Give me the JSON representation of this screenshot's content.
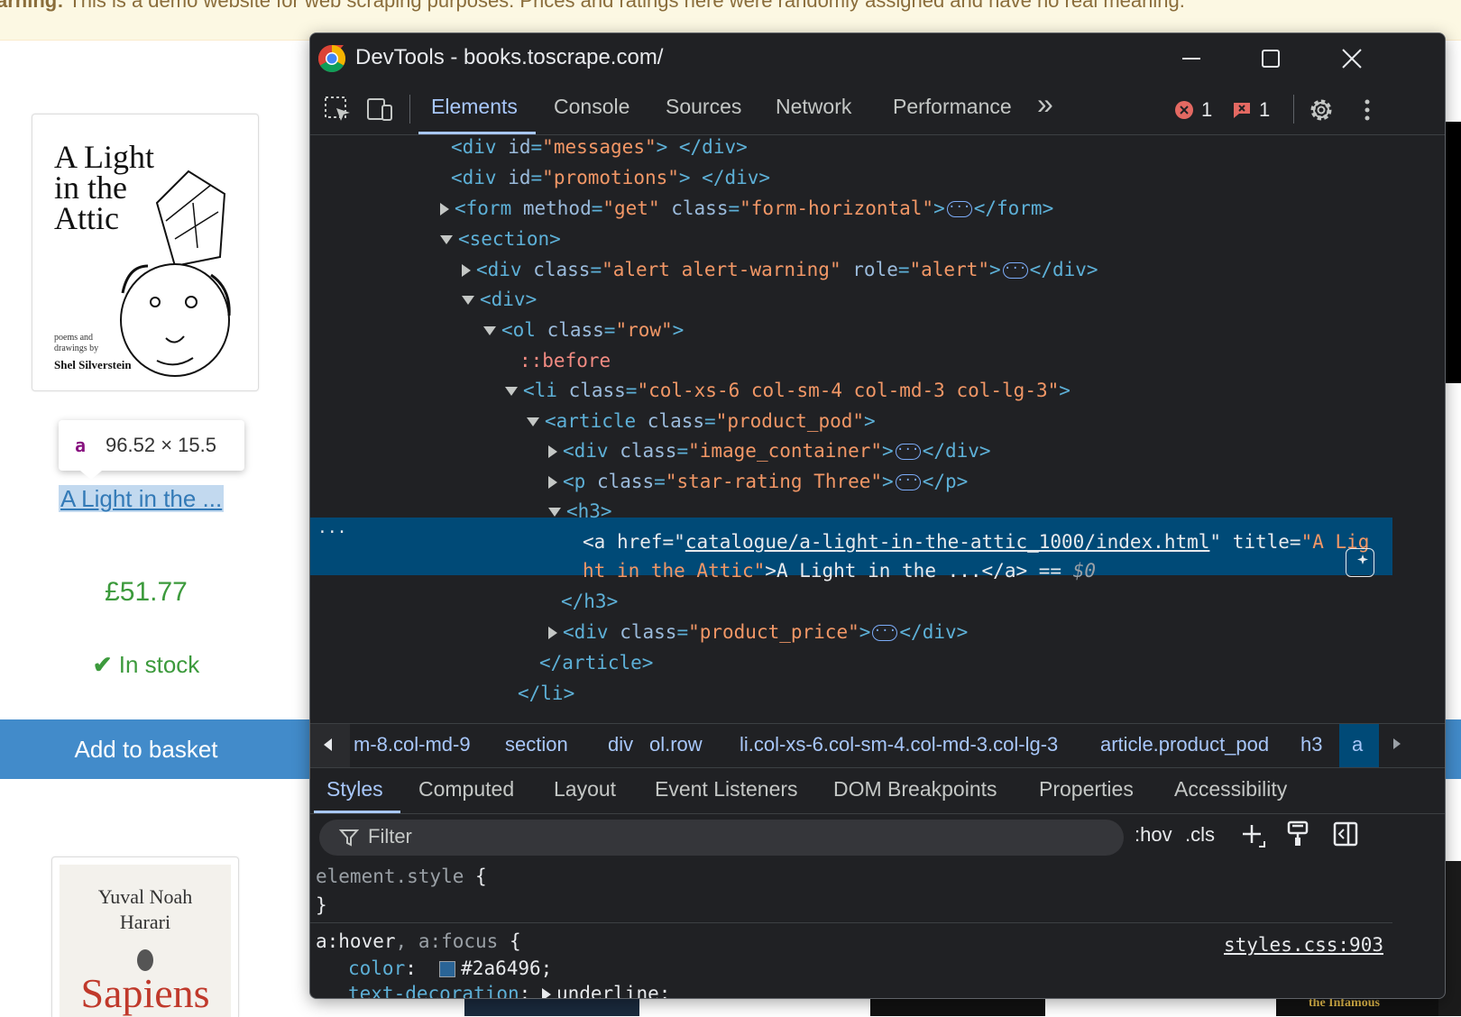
{
  "page": {
    "warning_prefix": "arning:",
    "warning_text": " This is a demo website for web scraping purposes. Prices and ratings here were randomly assigned and have no real meaning.",
    "book1": {
      "cover_title": "A Light\nin the\nAttic",
      "cover_sub": "poems and\ndrawings by",
      "cover_author": "Shel Silverstein",
      "link_text": "A Light in the ...",
      "price": "£51.77",
      "stock": "In stock",
      "basket": "Add to basket"
    },
    "book2": {
      "cover_author": "Yuval Noah\nHarari",
      "cover_title": "Sapiens"
    },
    "bottom_thumb_text": "the Infamous",
    "tooltip": {
      "tag": "a",
      "dims": "96.52 × 15.5"
    }
  },
  "devtools": {
    "title": "DevTools - books.toscrape.com/",
    "tabs": [
      "Elements",
      "Console",
      "Sources",
      "Network",
      "Performance"
    ],
    "more": "»",
    "errors": "1",
    "issues": "1",
    "dom": {
      "l1": {
        "tag": "div",
        "attr": "id",
        "val": "\"messages\""
      },
      "l2": {
        "tag": "div",
        "attr": "id",
        "val": "\"promotions\""
      },
      "l3": {
        "attr1": "method",
        "val1": "\"get\"",
        "attr2": "class",
        "val2": "\"form-horizontal\""
      },
      "l5": {
        "val1": "\"alert alert-warning\"",
        "attr2": "role",
        "val2": "\"alert\""
      },
      "l7": {
        "val": "\"row\""
      },
      "l8": "::before",
      "l9": {
        "val": "\"col-xs-6 col-sm-4 col-md-3 col-lg-3\""
      },
      "l10": {
        "val": "\"product_pod\""
      },
      "l11": {
        "val": "\"image_container\""
      },
      "l12": {
        "val": "\"star-rating Three\""
      },
      "sel": {
        "href": "catalogue/a-light-in-the-attic_1000/index.html",
        "title_part1": "\"A Lig",
        "title_part2": "ht in the Attic\"",
        "text": "A Light in the ...",
        "dollar": "$0"
      },
      "l16": {
        "val": "\"product_price\""
      }
    },
    "breadcrumbs": [
      "m-8.col-md-9",
      "section",
      "div",
      "ol.row",
      "li.col-xs-6.col-sm-4.col-md-3.col-lg-3",
      "article.product_pod",
      "h3",
      "a"
    ],
    "subtabs": [
      "Styles",
      "Computed",
      "Layout",
      "Event Listeners",
      "DOM Breakpoints",
      "Properties",
      "Accessibility"
    ],
    "filter_placeholder": "Filter",
    "hov": ":hov",
    "cls": ".cls",
    "styles": {
      "rule1_selector": "element.style",
      "rule2_selector1": "a:hover",
      "rule2_selector2": "a:focus",
      "rule2_source": "styles.css:903",
      "color_prop": "color",
      "color_val": "#2a6496",
      "td_prop": "text-decoration",
      "td_val": "underline"
    }
  }
}
